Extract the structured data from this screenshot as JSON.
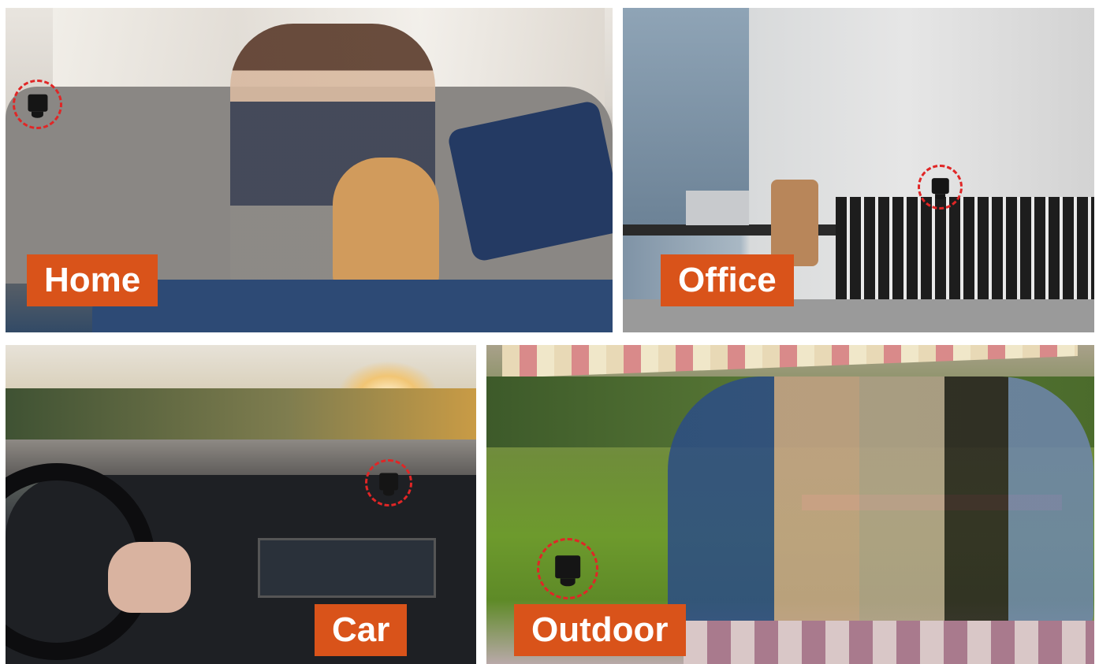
{
  "scenes": {
    "home": {
      "label": "Home"
    },
    "office": {
      "label": "Office"
    },
    "car": {
      "label": "Car"
    },
    "outdoor": {
      "label": "Outdoor"
    }
  },
  "colors": {
    "label_background": "#d9531a",
    "label_text": "#ffffff",
    "camera_marker": "#e02626"
  }
}
